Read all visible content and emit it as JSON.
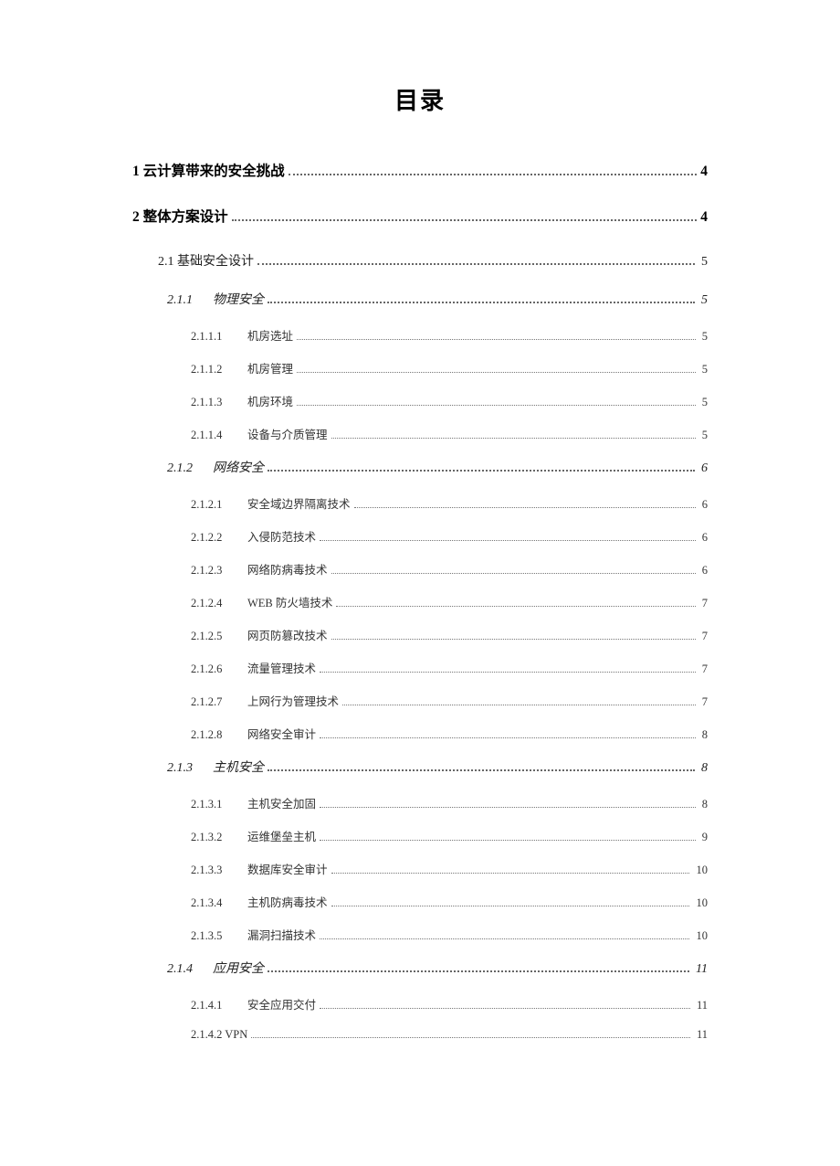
{
  "title": "目录",
  "entries": [
    {
      "level": 1,
      "num": "1",
      "title": "云计算带来的安全挑战",
      "page": "4"
    },
    {
      "level": 1,
      "num": "2",
      "title": "整体方案设计",
      "page": "4"
    },
    {
      "level": 2,
      "num": "2.1",
      "title": "基础安全设计",
      "page": "5"
    },
    {
      "level": 3,
      "num": "2.1.1",
      "title": "物理安全",
      "page": "5"
    },
    {
      "level": 4,
      "num": "2.1.1.1",
      "title": "机房选址",
      "page": "5"
    },
    {
      "level": 4,
      "num": "2.1.1.2",
      "title": "机房管理",
      "page": "5"
    },
    {
      "level": 4,
      "num": "2.1.1.3",
      "title": "机房环境",
      "page": "5"
    },
    {
      "level": 4,
      "num": "2.1.1.4",
      "title": "设备与介质管理",
      "page": "5"
    },
    {
      "level": 3,
      "num": "2.1.2",
      "title": "网络安全",
      "page": "6"
    },
    {
      "level": 4,
      "num": "2.1.2.1",
      "title": "安全域边界隔离技术",
      "page": "6"
    },
    {
      "level": 4,
      "num": "2.1.2.2",
      "title": "入侵防范技术",
      "page": "6"
    },
    {
      "level": 4,
      "num": "2.1.2.3",
      "title": "网络防病毒技术",
      "page": "6"
    },
    {
      "level": 4,
      "num": "2.1.2.4",
      "title": "WEB 防火墙技术",
      "page": "7"
    },
    {
      "level": 4,
      "num": "2.1.2.5",
      "title": "网页防篡改技术",
      "page": "7"
    },
    {
      "level": 4,
      "num": "2.1.2.6",
      "title": "流量管理技术",
      "page": "7"
    },
    {
      "level": 4,
      "num": "2.1.2.7",
      "title": "上网行为管理技术",
      "page": "7"
    },
    {
      "level": 4,
      "num": "2.1.2.8",
      "title": "网络安全审计",
      "page": "8"
    },
    {
      "level": 3,
      "num": "2.1.3",
      "title": "主机安全",
      "page": "8"
    },
    {
      "level": 4,
      "num": "2.1.3.1",
      "title": "主机安全加固",
      "page": "8"
    },
    {
      "level": 4,
      "num": "2.1.3.2",
      "title": "运维堡垒主机",
      "page": "9"
    },
    {
      "level": 4,
      "num": "2.1.3.3",
      "title": "数据库安全审计",
      "page": "10"
    },
    {
      "level": 4,
      "num": "2.1.3.4",
      "title": "主机防病毒技术",
      "page": "10"
    },
    {
      "level": 4,
      "num": "2.1.3.5",
      "title": "漏洞扫描技术",
      "page": "10"
    },
    {
      "level": 3,
      "num": "2.1.4",
      "title": "应用安全",
      "page": "11"
    },
    {
      "level": 4,
      "num": "2.1.4.1",
      "title": "安全应用交付",
      "page": "11"
    },
    {
      "level": "4b",
      "num": "2.1.4.2",
      "title": "VPN",
      "page": "11"
    }
  ]
}
